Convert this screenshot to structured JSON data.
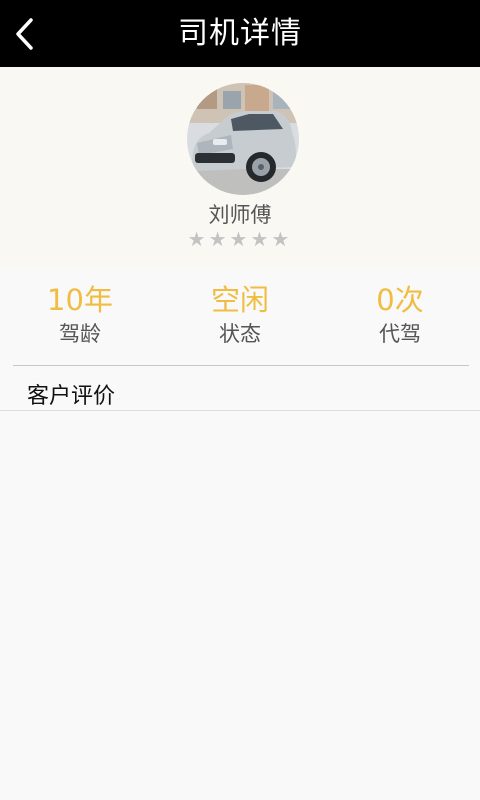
{
  "header": {
    "title": "司机详情",
    "back_icon": "chevron-left-icon"
  },
  "driver": {
    "avatar_icon": "car-photo",
    "name": "刘师傅",
    "rating": 0,
    "rating_max": 5,
    "stars_text": "★★★★★",
    "star_color": "#c3c3c3"
  },
  "stats": [
    {
      "value": "10年",
      "label": "驾龄"
    },
    {
      "value": "空闲",
      "label": "状态"
    },
    {
      "value": "0次",
      "label": "代驾"
    }
  ],
  "reviews": {
    "title": "客户评价",
    "items": []
  },
  "colors": {
    "titlebar": "#000000",
    "accent": "#f0bd42",
    "profile_bg": "#faf8f3"
  }
}
